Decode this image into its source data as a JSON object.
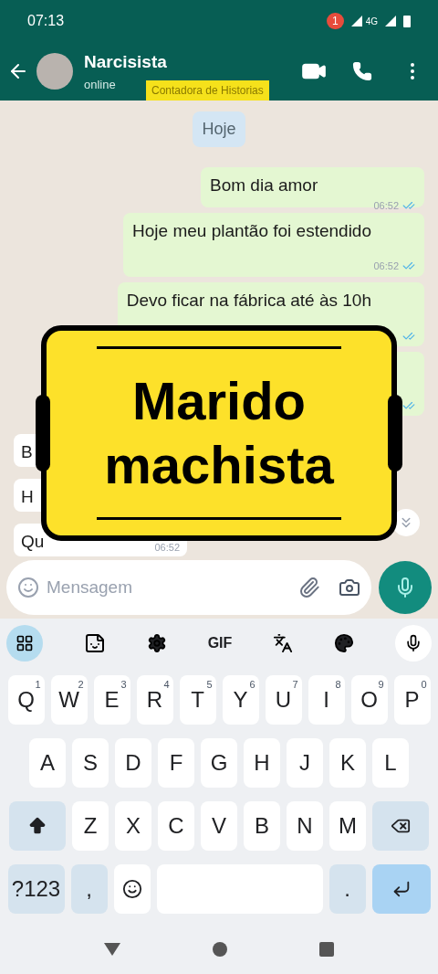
{
  "status_bar": {
    "time": "07:13",
    "notification_count": "1",
    "network": "4G"
  },
  "header": {
    "name": "Narcisista",
    "status": "online",
    "tag": "Contadora de Historias"
  },
  "date_chip": "Hoje",
  "messages": [
    {
      "kind": "sent",
      "text": "Bom dia amor",
      "time": "06:52",
      "read": true
    },
    {
      "kind": "sent",
      "text": "Hoje meu plantão foi estendido",
      "time": "06:52",
      "read": true
    },
    {
      "kind": "sent",
      "text": "Devo ficar na fábrica até às 10h",
      "read": true
    },
    {
      "kind": "sent",
      "read": true
    },
    {
      "kind": "received",
      "text": "B"
    },
    {
      "kind": "received",
      "text": "H"
    },
    {
      "kind": "received",
      "text": "Qu",
      "time": "06:52"
    }
  ],
  "sticker": {
    "lines": [
      "Marido",
      "machista"
    ]
  },
  "composer": {
    "placeholder": "Mensagem"
  },
  "keyboard": {
    "toolbar": {
      "gif": "GIF"
    },
    "rows": [
      [
        {
          "kind": "letter",
          "label": "Q",
          "hint": "1"
        },
        {
          "kind": "letter",
          "label": "W",
          "hint": "2"
        },
        {
          "kind": "letter",
          "label": "E",
          "hint": "3"
        },
        {
          "kind": "letter",
          "label": "R",
          "hint": "4"
        },
        {
          "kind": "letter",
          "label": "T",
          "hint": "5"
        },
        {
          "kind": "letter",
          "label": "Y",
          "hint": "6"
        },
        {
          "kind": "letter",
          "label": "U",
          "hint": "7"
        },
        {
          "kind": "letter",
          "label": "I",
          "hint": "8"
        },
        {
          "kind": "letter",
          "label": "O",
          "hint": "9"
        },
        {
          "kind": "letter",
          "label": "P",
          "hint": "0"
        }
      ],
      [
        {
          "kind": "letter",
          "label": "A"
        },
        {
          "kind": "letter",
          "label": "S"
        },
        {
          "kind": "letter",
          "label": "D"
        },
        {
          "kind": "letter",
          "label": "F"
        },
        {
          "kind": "letter",
          "label": "G"
        },
        {
          "kind": "letter",
          "label": "H"
        },
        {
          "kind": "letter",
          "label": "J"
        },
        {
          "kind": "letter",
          "label": "K"
        },
        {
          "kind": "letter",
          "label": "L"
        }
      ],
      [
        {
          "kind": "shift"
        },
        {
          "kind": "letter",
          "label": "Z"
        },
        {
          "kind": "letter",
          "label": "X"
        },
        {
          "kind": "letter",
          "label": "C"
        },
        {
          "kind": "letter",
          "label": "V"
        },
        {
          "kind": "letter",
          "label": "B"
        },
        {
          "kind": "letter",
          "label": "N"
        },
        {
          "kind": "letter",
          "label": "M"
        },
        {
          "kind": "backspace"
        }
      ]
    ],
    "bottom_row": [
      {
        "kind": "symbols",
        "label": "?123"
      },
      {
        "kind": "punct",
        "label": ","
      },
      {
        "kind": "emoji"
      },
      {
        "kind": "space"
      },
      {
        "kind": "punct",
        "label": "."
      },
      {
        "kind": "enter"
      }
    ]
  }
}
